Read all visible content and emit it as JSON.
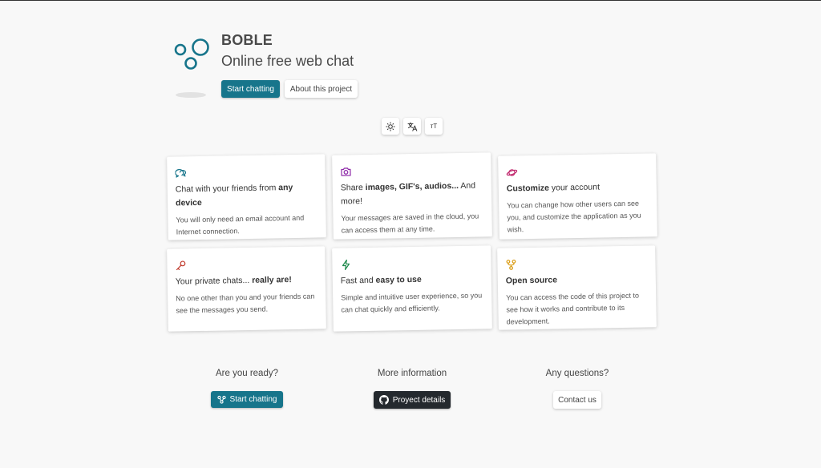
{
  "header": {
    "brand": "BOBLE",
    "tagline": "Online free web chat",
    "start_label": "Start chatting",
    "about_label": "About this project"
  },
  "toolbar": {
    "theme_icon": "sun-icon",
    "translate_icon": "translate-icon",
    "font_size_label": "тT"
  },
  "features": [
    {
      "icon": "chat-bubbles-icon",
      "color": "#17758b",
      "title_pre": "Chat with your friends from ",
      "title_bold": "any device",
      "title_post": "",
      "desc": "You will only need an email account and Internet connection."
    },
    {
      "icon": "camera-icon",
      "color": "#8e2aa8",
      "title_pre": "Share ",
      "title_bold": "images, GIF's, audios...",
      "title_post": " And more!",
      "desc": "Your messages are saved in the cloud, you can access them at any time."
    },
    {
      "icon": "planet-icon",
      "color": "#c0286d",
      "title_pre": "",
      "title_bold": "Customize",
      "title_post": " your account",
      "desc": "You can change how other users can see you, and customize the application as you wish."
    },
    {
      "icon": "key-icon",
      "color": "#c0392b",
      "title_pre": "Your private chats... ",
      "title_bold": "really are!",
      "title_post": "",
      "desc": "No one other than you and your friends can see the messages you send."
    },
    {
      "icon": "lightning-icon",
      "color": "#1f8a4c",
      "title_pre": "Fast and ",
      "title_bold": "easy to use",
      "title_post": "",
      "desc": "Simple and intuitive user experience, so you can chat quickly and efficiently."
    },
    {
      "icon": "fork-icon",
      "color": "#d99a0f",
      "title_pre": "",
      "title_bold": "Open source",
      "title_post": "",
      "desc": "You can access the code of this project to see how it works and contribute to its development."
    }
  ],
  "cta": {
    "ready_heading": "Are you ready?",
    "ready_button": "Start chatting",
    "info_heading": "More information",
    "info_button": "Proyect details",
    "questions_heading": "Any questions?",
    "questions_button": "Contact us"
  },
  "colors": {
    "primary": "#17758b",
    "dark": "#24292e",
    "background": "#f8f8f8"
  }
}
